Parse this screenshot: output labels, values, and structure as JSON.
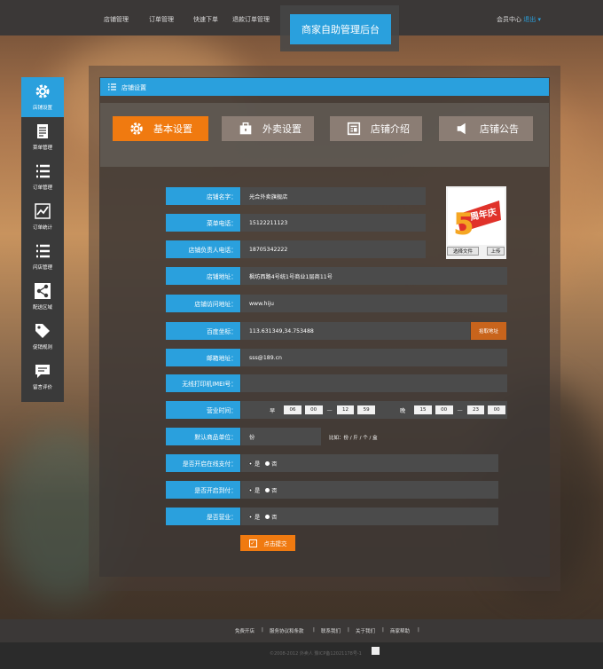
{
  "header": {
    "nav": [
      "店铺管理",
      "订单管理",
      "快速下单",
      "退款订单管理"
    ],
    "brand": "商家自助管理后台",
    "member_label": "会员中心",
    "logout_label": "退出"
  },
  "sidebar": {
    "items": [
      {
        "label": "店铺设置",
        "icon": "gear-icon",
        "active": true
      },
      {
        "label": "菜单管理",
        "icon": "document-icon",
        "active": false
      },
      {
        "label": "订单管理",
        "icon": "list-icon",
        "active": false
      },
      {
        "label": "订单统计",
        "icon": "line-chart-icon",
        "active": false
      },
      {
        "label": "闪店管理",
        "icon": "list-icon",
        "active": false
      },
      {
        "label": "配送区域",
        "icon": "share-icon",
        "active": false
      },
      {
        "label": "促销规则",
        "icon": "tag-icon",
        "active": false
      },
      {
        "label": "留言评价",
        "icon": "comment-icon",
        "active": false
      }
    ]
  },
  "panel": {
    "title": "店铺设置",
    "tabs": [
      {
        "label": "基本设置",
        "icon": "gear-icon",
        "active": true
      },
      {
        "label": "外卖设置",
        "icon": "briefcase-icon",
        "active": false
      },
      {
        "label": "店铺介绍",
        "icon": "document-icon",
        "active": false
      },
      {
        "label": "店铺公告",
        "icon": "speaker-icon",
        "active": false
      }
    ]
  },
  "form": {
    "store_name": {
      "label": "店铺名字：",
      "value": "光合外卖旗舰店"
    },
    "phone": {
      "label": "菜单电话：",
      "value": "15122211123"
    },
    "manager_phone": {
      "label": "店铺负责人电话：",
      "value": "18705342222"
    },
    "address": {
      "label": "店铺地址：",
      "value": "枫坊西路4号统1号商业1层商11号"
    },
    "url": {
      "label": "店铺访问地址：",
      "value": "www.hiju"
    },
    "coords": {
      "label": "百度坐标：",
      "value": "113.631349,34.753488",
      "button": "拾取地址"
    },
    "email": {
      "label": "邮箱地址：",
      "value": "sss@189.cn"
    },
    "printer": {
      "label": "无线打印机IMEI号：",
      "value": ""
    },
    "hours": {
      "label": "营业时间：",
      "morning_label": "早",
      "morning": {
        "start_h": "06",
        "start_m": "00",
        "end_h": "12",
        "end_m": "59"
      },
      "evening_label": "晚",
      "evening": {
        "start_h": "15",
        "start_m": "00",
        "end_h": "23",
        "end_m": "00"
      },
      "separator": "—"
    },
    "unit": {
      "label": "默认商品单位：",
      "value": "份",
      "hint": "比如：份 / 斤 / 个 / 盒"
    },
    "online_pay": {
      "label": "是否开启在线支付：",
      "yes": "是",
      "no": "否"
    },
    "cod": {
      "label": "是否开启到付：",
      "yes": "是",
      "no": "否"
    },
    "open": {
      "label": "是否营业：",
      "yes": "是",
      "no": "否"
    },
    "submit": "点击提交",
    "file_choose": "选择文件",
    "upload": "上传",
    "logo_text": "5周年庆"
  },
  "footer": {
    "links": [
      "免费开店",
      "服务协议和条款",
      "联系我们",
      "关于我们",
      "商家帮助"
    ],
    "divider": "|",
    "copyright": "©2008-2012 外卖人  豫ICP备12021178号-1"
  },
  "colors": {
    "accent": "#2aa0dd",
    "orange": "#f07a10",
    "bar": "#3b3837"
  }
}
